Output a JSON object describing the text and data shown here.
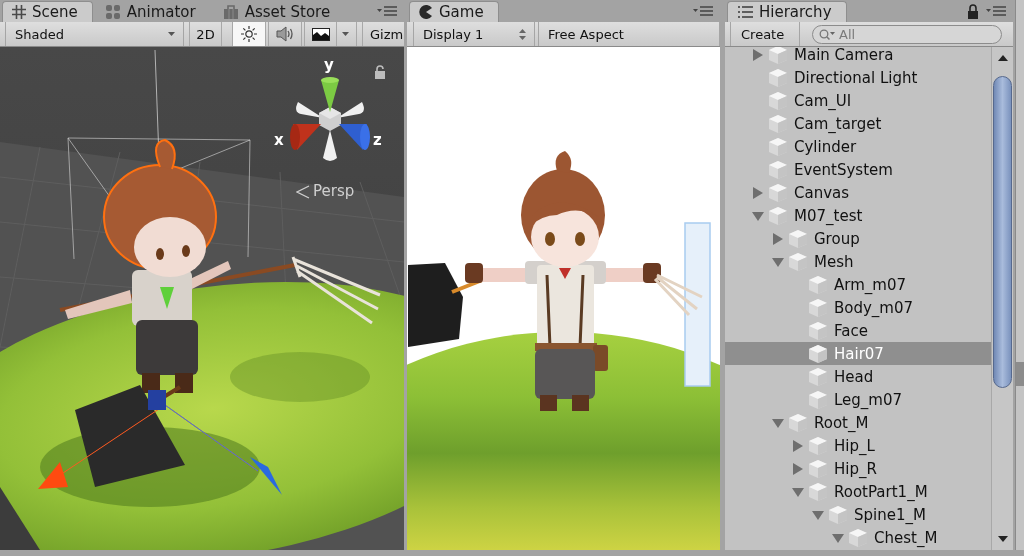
{
  "scene_panel": {
    "tabs": [
      {
        "kind": "scene",
        "label": "Scene",
        "selected": true
      },
      {
        "kind": "animator",
        "label": "Animator",
        "selected": false
      },
      {
        "kind": "store",
        "label": "Asset Store",
        "selected": false
      }
    ],
    "toolbar": {
      "shading": "Shaded",
      "buttons": [
        {
          "kind": "text",
          "label": "2D",
          "on": false
        },
        {
          "kind": "lighting",
          "on": true
        },
        {
          "kind": "audio",
          "on": false
        },
        {
          "kind": "effects",
          "on": false
        }
      ],
      "gizmos": "Gizm"
    },
    "viewport": {
      "axes": {
        "x": "x",
        "y": "y",
        "z": "z"
      },
      "projection": "Persp"
    }
  },
  "game_panel": {
    "tabs": [
      {
        "kind": "game",
        "label": "Game",
        "selected": true
      }
    ],
    "toolbar": {
      "display": "Display 1",
      "aspect": "Free Aspect"
    }
  },
  "hierarchy_panel": {
    "tabs": [
      {
        "kind": "hierarchy",
        "label": "Hierarchy",
        "selected": true
      }
    ],
    "create": "Create",
    "search": {
      "placeholder": "All"
    },
    "items": [
      {
        "name": "Main Camera",
        "expanded": false,
        "selected": false
      },
      {
        "name": "Directional Light",
        "selected": false
      },
      {
        "name": "Cam_UI",
        "selected": false
      },
      {
        "name": "Cam_target",
        "selected": false
      },
      {
        "name": "Cylinder",
        "selected": false
      },
      {
        "name": "EventSystem",
        "selected": false
      },
      {
        "name": "Canvas",
        "expanded": false,
        "selected": false
      },
      {
        "name": "M07_test",
        "expanded": true,
        "selected": false,
        "children": [
          {
            "name": "Group",
            "expanded": false,
            "selected": false
          },
          {
            "name": "Mesh",
            "expanded": true,
            "selected": false,
            "children": [
              {
                "name": "Arm_m07",
                "selected": false
              },
              {
                "name": "Body_m07",
                "selected": false
              },
              {
                "name": "Face",
                "selected": false
              },
              {
                "name": "Hair07",
                "selected": true
              },
              {
                "name": "Head",
                "selected": false
              },
              {
                "name": "Leg_m07",
                "selected": false
              }
            ]
          },
          {
            "name": "Root_M",
            "expanded": true,
            "selected": false,
            "children": [
              {
                "name": "Hip_L",
                "expanded": false,
                "selected": false
              },
              {
                "name": "Hip_R",
                "expanded": false,
                "selected": false
              },
              {
                "name": "RootPart1_M",
                "expanded": true,
                "selected": false,
                "children": [
                  {
                    "name": "Spine1_M",
                    "expanded": true,
                    "selected": false,
                    "children": [
                      {
                        "name": "Chest_M",
                        "expanded": true,
                        "selected": false
                      }
                    ]
                  }
                ]
              }
            ]
          }
        ]
      }
    ]
  }
}
